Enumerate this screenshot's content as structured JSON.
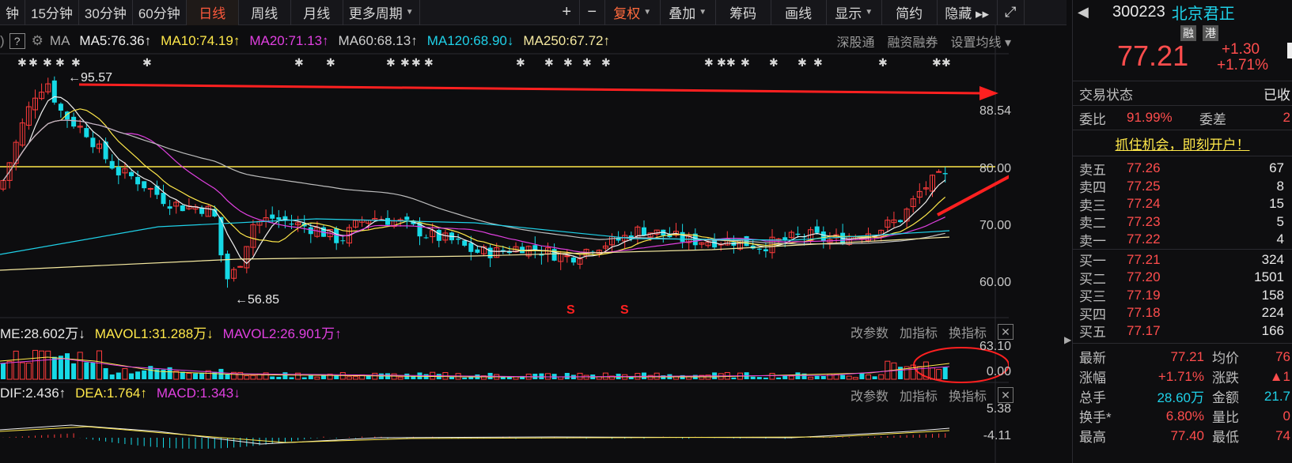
{
  "toolbar": {
    "items": [
      "钟",
      "15分钟",
      "30分钟",
      "60分钟",
      "日线",
      "周线",
      "月线",
      "更多周期",
      "+",
      "−",
      "复权",
      "叠加",
      "筹码",
      "画线",
      "显示",
      "简约",
      "隐藏 ▸▸"
    ],
    "active": "日线"
  },
  "ma_legend": {
    "ma_label": "MA",
    "ma5": "MA5:76.36↑",
    "ma10": "MA10:74.19↑",
    "ma20": "MA20:71.13↑",
    "ma60": "MA60:68.13↑",
    "ma120": "MA120:68.90↓",
    "ma250": "MA250:67.72↑",
    "links": [
      "深股通",
      "融资融券",
      "设置均线"
    ]
  },
  "price_axis": {
    "top": "88.54",
    "l80": "80.00",
    "l70": "70.00",
    "l60": "60.00"
  },
  "annotations": {
    "high": "←95.57",
    "low": "←56.85",
    "s_marker": "S"
  },
  "vol_legend": {
    "vol": "ME:28.602万↓",
    "mavol1": "MAVOL1:31.288万↓",
    "mavol2": "MAVOL2:26.901万↑",
    "axis_top": "63.10",
    "axis_bot": "0.00"
  },
  "macd_legend": {
    "dif": "DIF:2.436↑",
    "dea": "DEA:1.764↑",
    "macd": "MACD:1.343↓",
    "axis_top": "5.38",
    "axis_bot": "-4.11"
  },
  "sub_controls": [
    "改参数",
    "加指标",
    "换指标"
  ],
  "colors": {
    "up": "#ff3b3b",
    "down": "#16d9e6",
    "yellow": "#ffe84a",
    "magenta": "#e040e0"
  },
  "stock": {
    "code": "300223",
    "name": "北京君正",
    "badge1": "融",
    "badge2": "港",
    "price": "77.21",
    "change": "+1.30",
    "pct": "+1.71%",
    "status_label": "交易状态",
    "status_value": "已收",
    "weibi_label": "委比",
    "weibi_value": "91.99%",
    "weicha_label": "委差",
    "weicha_value": "2",
    "promo": "抓住机会，即刻开户！"
  },
  "asks": [
    {
      "label": "卖五",
      "price": "77.26",
      "vol": "67"
    },
    {
      "label": "卖四",
      "price": "77.25",
      "vol": "8"
    },
    {
      "label": "卖三",
      "price": "77.24",
      "vol": "15"
    },
    {
      "label": "卖二",
      "price": "77.23",
      "vol": "5"
    },
    {
      "label": "卖一",
      "price": "77.22",
      "vol": "4"
    }
  ],
  "bids": [
    {
      "label": "买一",
      "price": "77.21",
      "vol": "324"
    },
    {
      "label": "买二",
      "price": "77.20",
      "vol": "1501"
    },
    {
      "label": "买三",
      "price": "77.19",
      "vol": "158"
    },
    {
      "label": "买四",
      "price": "77.18",
      "vol": "224"
    },
    {
      "label": "买五",
      "price": "77.17",
      "vol": "166"
    }
  ],
  "stats": [
    {
      "l1": "最新",
      "v1": "77.21",
      "l2": "均价",
      "v2": "76"
    },
    {
      "l1": "涨幅",
      "v1": "+1.71%",
      "l2": "涨跌",
      "v2": "▲1"
    },
    {
      "l1": "总手",
      "v1": "28.60万",
      "l2": "金额",
      "v2": "21.7"
    },
    {
      "l1": "换手*",
      "v1": "6.80%",
      "l2": "量比",
      "v2": "0"
    },
    {
      "l1": "最高",
      "v1": "77.40",
      "l2": "最低",
      "v2": "74"
    }
  ]
}
